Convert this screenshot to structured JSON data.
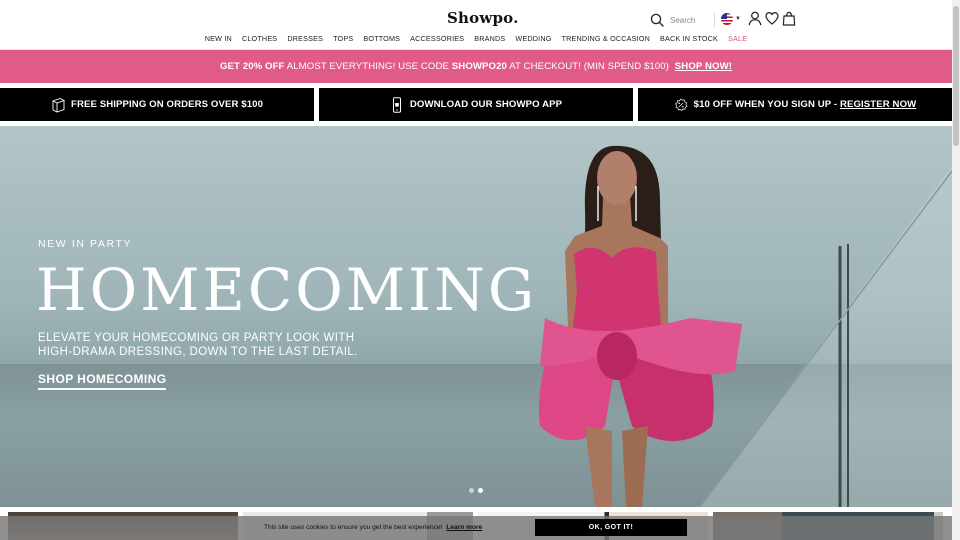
{
  "header": {
    "logo": "Showpo.",
    "search_placeholder": "Search"
  },
  "nav": [
    {
      "label": "NEW IN"
    },
    {
      "label": "CLOTHES"
    },
    {
      "label": "DRESSES"
    },
    {
      "label": "TOPS"
    },
    {
      "label": "BOTTOMS"
    },
    {
      "label": "ACCESSORIES"
    },
    {
      "label": "BRANDS"
    },
    {
      "label": "WEDDING"
    },
    {
      "label": "TRENDING & OCCASION"
    },
    {
      "label": "BACK IN STOCK"
    },
    {
      "label": "SALE"
    }
  ],
  "promo": {
    "lead": "GET 20% OFF",
    "middle": " ALMOST EVERYTHING! USE CODE ",
    "code": "SHOWPO20",
    "tail": " AT CHECKOUT! (MIN SPEND $100) ",
    "link": "SHOP NOW!"
  },
  "info_bars": [
    {
      "text": "FREE SHIPPING ON ORDERS OVER $100",
      "icon": "shipping-box-icon"
    },
    {
      "text": "DOWNLOAD OUR SHOWPO APP",
      "icon": "phone-icon"
    },
    {
      "text": "$10 OFF WHEN YOU SIGN UP - ",
      "link": "REGISTER NOW",
      "icon": "discount-badge-icon"
    }
  ],
  "hero": {
    "eyebrow": "NEW IN PARTY",
    "headline": "HOMECOMING",
    "subcopy_line1": "ELEVATE YOUR HOMECOMING OR PARTY LOOK WITH",
    "subcopy_line2": "HIGH-DRAMA DRESSING, DOWN TO THE LAST DETAIL.",
    "cta": "SHOP HOMECOMING",
    "slides_total": 2,
    "active_slide": 2
  },
  "cookie": {
    "text": "This site uses cookies to ensure you get the best experience!",
    "link": "Learn more",
    "button": "OK, GOT IT!"
  },
  "colors": {
    "promo_bg": "#e05b8a",
    "sale": "#e5507f",
    "info_bg": "#000000",
    "dress": "#d93a7a"
  }
}
